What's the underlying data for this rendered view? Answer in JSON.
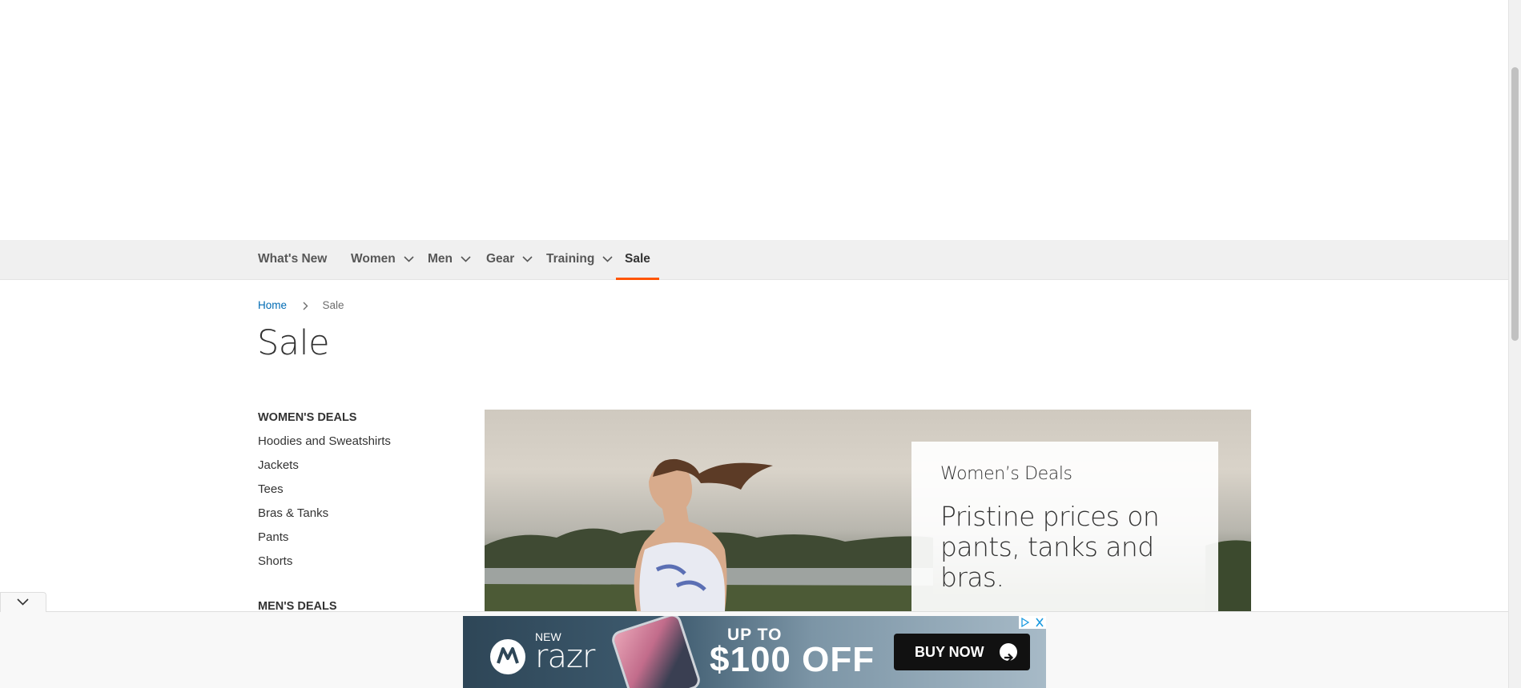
{
  "nav": {
    "items": [
      {
        "label": "What's New",
        "has_dropdown": false
      },
      {
        "label": "Women",
        "has_dropdown": true
      },
      {
        "label": "Men",
        "has_dropdown": true
      },
      {
        "label": "Gear",
        "has_dropdown": true
      },
      {
        "label": "Training",
        "has_dropdown": true
      },
      {
        "label": "Sale",
        "has_dropdown": false,
        "active": true
      }
    ],
    "active_color": "#ff5501"
  },
  "breadcrumb": {
    "home": "Home",
    "current": "Sale"
  },
  "page": {
    "title": "Sale"
  },
  "sidebar": {
    "womens_heading": "WOMEN'S DEALS",
    "womens_links": [
      "Hoodies and Sweatshirts",
      "Jackets",
      "Tees",
      "Bras & Tanks",
      "Pants",
      "Shorts"
    ],
    "mens_heading": "MEN'S DEALS"
  },
  "hero": {
    "small_title": "Women’s Deals",
    "headline": "Pristine prices on pants, tanks and bras."
  },
  "ad": {
    "new": "NEW",
    "brand": "razr",
    "up_to": "UP TO",
    "offer": "$100 OFF",
    "cta": "BUY NOW"
  },
  "colors": {
    "link": "#006bb4",
    "nav_bg": "#f0f0f0",
    "accent": "#ff5501"
  }
}
